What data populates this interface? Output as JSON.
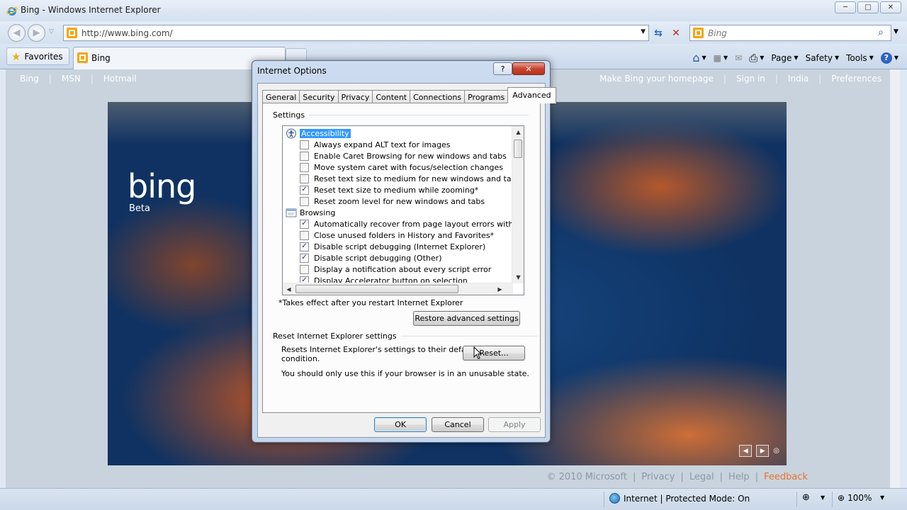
{
  "window": {
    "title": "Bing - Windows Internet Explorer",
    "controls": {
      "minimize": "─",
      "maximize": "□",
      "close": "✕"
    }
  },
  "navbar": {
    "back_glyph": "◀",
    "forward_glyph": "▶",
    "dropdown_glyph": "▽",
    "url": "http://www.bing.com/",
    "url_dropdown": "▼",
    "refresh_glyph": "⇆",
    "stop_glyph": "✕",
    "search_placeholder": "Bing",
    "search_glyph": "⌕",
    "search_dropdown": "▼"
  },
  "favbar": {
    "favorites_label": "Favorites",
    "tab_label": "Bing",
    "commands": {
      "home": "⌂",
      "feeds": "▦",
      "mail": "✉",
      "print": "⎙",
      "page": "Page",
      "safety": "Safety",
      "tools": "Tools",
      "help": "?"
    }
  },
  "bing": {
    "nav_left": [
      "Bing",
      "MSN",
      "Hotmail"
    ],
    "nav_right": [
      "Make Bing your homepage",
      "Sign in",
      "India",
      "Preferences"
    ],
    "separator": "|",
    "logo": "bing",
    "beta": "Beta",
    "hero_controls": {
      "prev": "◀",
      "next": "▶",
      "info": "◎"
    },
    "footer": {
      "copyright": "© 2010 Microsoft",
      "links": [
        "Privacy",
        "Legal",
        "Help"
      ],
      "feedback": "Feedback"
    }
  },
  "dialog": {
    "title": "Internet Options",
    "help": "?",
    "close": "✕",
    "tabs": [
      "General",
      "Security",
      "Privacy",
      "Content",
      "Connections",
      "Programs",
      "Advanced"
    ],
    "active_tab": "Advanced",
    "settings_label": "Settings",
    "tree": [
      {
        "type": "category",
        "label": "Accessibility",
        "icon": "accessibility-icon",
        "selected": true
      },
      {
        "type": "check",
        "label": "Always expand ALT text for images",
        "checked": false
      },
      {
        "type": "check",
        "label": "Enable Caret Browsing for new windows and tabs",
        "checked": false
      },
      {
        "type": "check",
        "label": "Move system caret with focus/selection changes",
        "checked": false
      },
      {
        "type": "check",
        "label": "Reset text size to medium for new windows and tabs",
        "checked": false
      },
      {
        "type": "check",
        "label": "Reset text size to medium while zooming*",
        "checked": true
      },
      {
        "type": "check",
        "label": "Reset zoom level for new windows and tabs",
        "checked": false
      },
      {
        "type": "category",
        "label": "Browsing",
        "icon": "browsing-icon",
        "selected": false
      },
      {
        "type": "check",
        "label": "Automatically recover from page layout errors with Compa",
        "checked": true
      },
      {
        "type": "check",
        "label": "Close unused folders in History and Favorites*",
        "checked": false
      },
      {
        "type": "check",
        "label": "Disable script debugging (Internet Explorer)",
        "checked": true
      },
      {
        "type": "check",
        "label": "Disable script debugging (Other)",
        "checked": true
      },
      {
        "type": "check",
        "label": "Display a notification about every script error",
        "checked": false
      },
      {
        "type": "check",
        "label": "Display Accelerator button on selection",
        "checked": true
      }
    ],
    "check_glyph": "✓",
    "restart_note": "*Takes effect after you restart Internet Explorer",
    "restore_button": "Restore advanced settings",
    "reset_group_label": "Reset Internet Explorer settings",
    "reset_desc_line1": "Resets Internet Explorer's settings to their default",
    "reset_desc_line2": "condition.",
    "reset_button": "Reset...",
    "reset_warning": "You should only use this if your browser is in an unusable state.",
    "ok": "OK",
    "cancel": "Cancel",
    "apply": "Apply"
  },
  "statusbar": {
    "zone": "Internet | Protected Mode: On",
    "protected_glyph": "⊕",
    "zoom": "100%",
    "zoom_glyph": "⊕",
    "dropdown": "▼"
  },
  "colors": {
    "selection": "#3399ff",
    "feedback_link": "#e47434",
    "dialog_frame": "#bcd0ea"
  }
}
